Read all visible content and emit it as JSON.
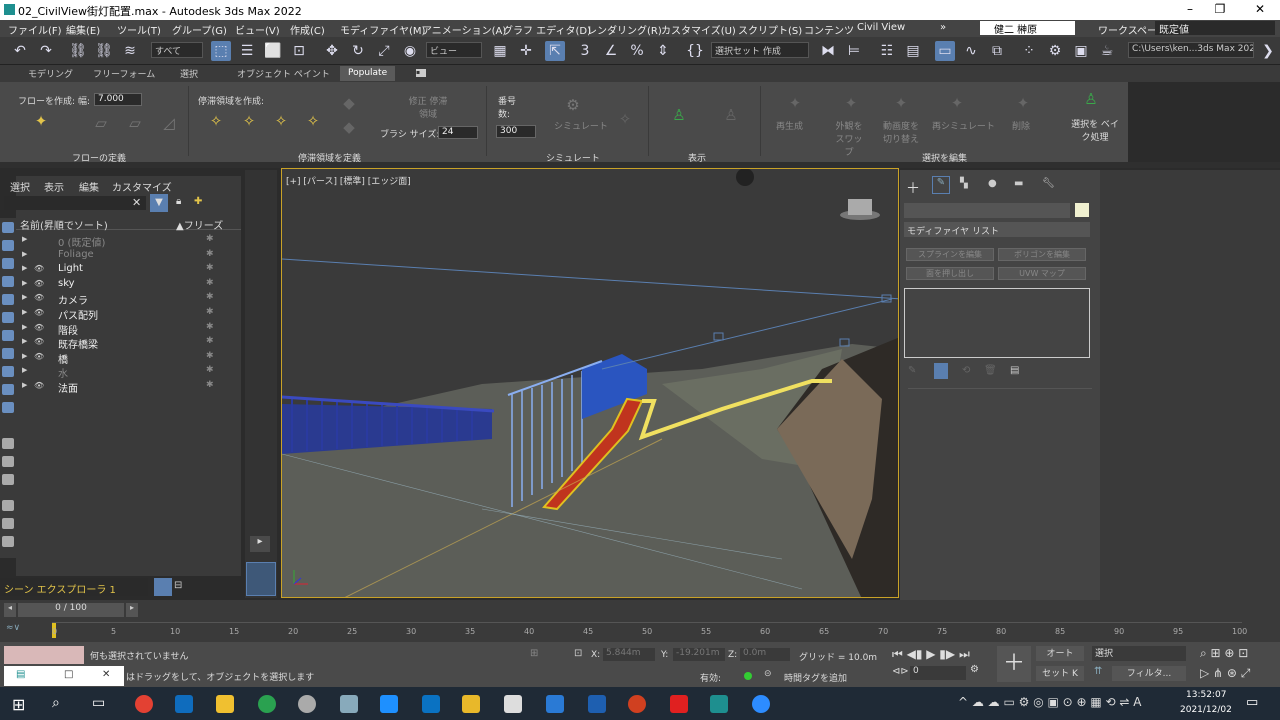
{
  "window": {
    "title": "02_CivilView街灯配置.max - Autodesk 3ds Max 2022",
    "minimize": "–",
    "restore": "❐",
    "close": "✕"
  },
  "menu": [
    "ファイル(F)",
    "編集(E)",
    "ツール(T)",
    "グループ(G)",
    "ビュー(V)",
    "作成(C)",
    "モディファイヤ(M)",
    "アニメーション(A)",
    "グラフ エディタ(D)",
    "レンダリング(R)",
    "カスタマイズ(U)",
    "スクリプト(S)",
    "コンテンツ",
    "Civil View"
  ],
  "user": {
    "name": "健二 榊原",
    "workspace_label": "ワークスペース:",
    "workspace_value": "既定値"
  },
  "toolbar": {
    "filter": "すべて",
    "refcoord": "ビュー",
    "selset": "選択セット 作成",
    "path": "C:\\Users\\ken...3ds Max 2022"
  },
  "ribbon_tabs": [
    "モデリング",
    "フリーフォーム",
    "選択",
    "オブジェクト ペイント",
    "Populate"
  ],
  "ribbon": {
    "flow_create": "フローを作成:",
    "width_label": "幅:",
    "width_value": "7.000",
    "flow_group": "フローの定義",
    "idle_create": "停滞領域を作成:",
    "idle_group": "停滞領域を定義",
    "modify_idle": "修正 停滞領域",
    "brush_label": "ブラシ サイズ:",
    "brush_value": "24",
    "count_label": "番号 数:",
    "count_value": "300",
    "simulate": "シミュレート",
    "simulate_group": "シミュレート",
    "display_group": "表示",
    "regen": "再生成",
    "swap_look": "外観を スワップ",
    "swap_motion": "動画度を 切り替え",
    "resim": "再シミュレート",
    "delete": "削除",
    "bake": "選択を ベイク処理",
    "edit_group": "選択を編集"
  },
  "explorer": {
    "menu": [
      "選択",
      "表示",
      "編集",
      "カスタマイズ"
    ],
    "col_name": "名前(昇順でソート)",
    "col_freeze": "▲フリーズ",
    "layers": [
      {
        "name": "0 (既定値)",
        "dim": true
      },
      {
        "name": "Foliage",
        "dim": true
      },
      {
        "name": "Light",
        "dim": false
      },
      {
        "name": "sky",
        "dim": false
      },
      {
        "name": "カメラ",
        "dim": false
      },
      {
        "name": "パス配列",
        "dim": false
      },
      {
        "name": "階段",
        "dim": false
      },
      {
        "name": "既存橋梁",
        "dim": false
      },
      {
        "name": "橋",
        "dim": false
      },
      {
        "name": "水",
        "dim": true
      },
      {
        "name": "法面",
        "dim": false
      }
    ],
    "footer": "シーン エクスプローラ 1"
  },
  "viewport": {
    "label": "[+] [パース] [標準] [エッジ面]"
  },
  "command_panel": {
    "modifier_list": "モディファイヤ リスト",
    "btn1": "スプラインを編集",
    "btn2": "ポリゴンを編集",
    "btn3": "面を押し出し",
    "btn4": "UVW マップ"
  },
  "timeline": {
    "frame": "0 / 100",
    "ticks": [
      "0",
      "5",
      "10",
      "15",
      "20",
      "25",
      "30",
      "35",
      "40",
      "45",
      "50",
      "55",
      "60",
      "65",
      "70",
      "75",
      "80",
      "85",
      "90",
      "95",
      "100"
    ]
  },
  "status": {
    "line1": "何も選択されていません",
    "line2": "はドラッグをして、オブジェクトを選択します",
    "x_label": "X:",
    "x_val": "5.844m",
    "y_label": "Y:",
    "y_val": "-19.201m",
    "z_label": "Z:",
    "z_val": "0.0m",
    "grid": "グリッド = 10.0m",
    "enabled": "有効:",
    "add_tag": "時間タグを追加",
    "auto": "オート",
    "set_key": "セット K",
    "sel": "選択",
    "filter": "フィルタ...",
    "frame_val": "0"
  },
  "taskbar": {
    "time": "13:52:07",
    "date": "2021/12/02"
  }
}
